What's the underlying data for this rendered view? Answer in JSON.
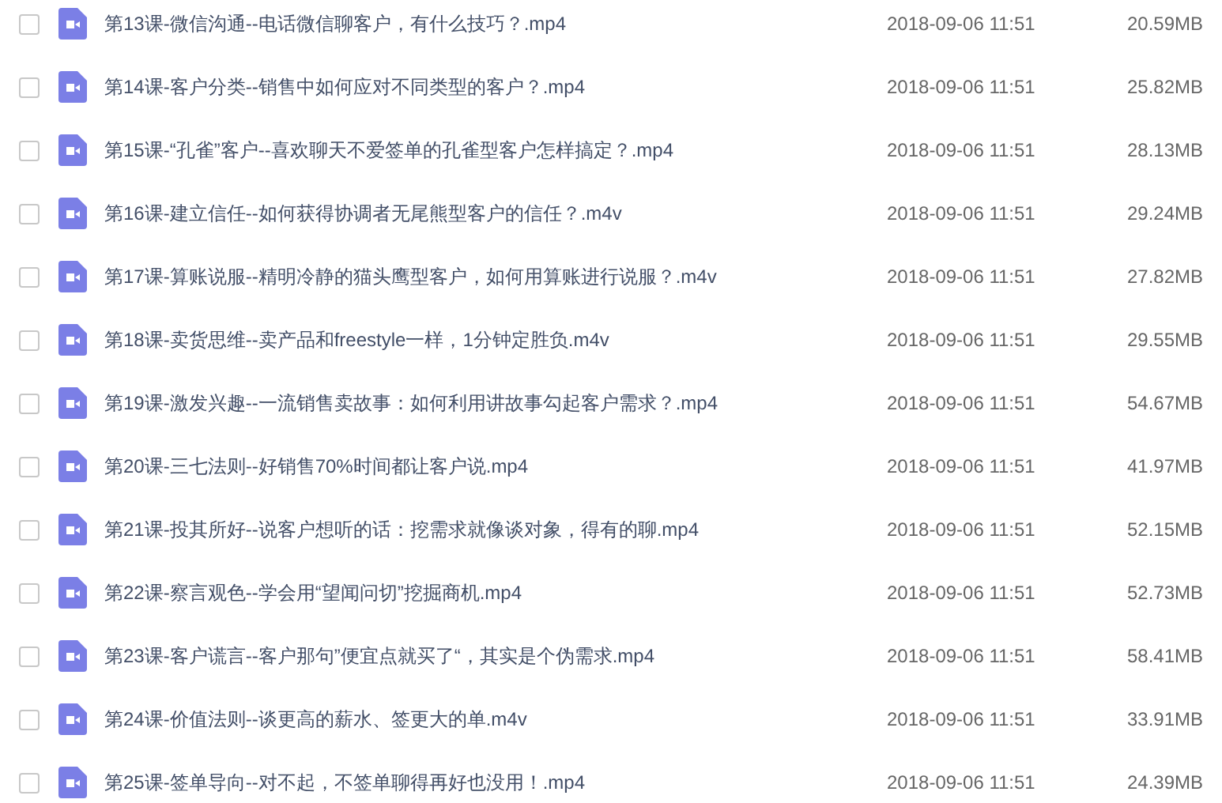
{
  "files": [
    {
      "name": "第13课-微信沟通--电话微信聊客户，有什么技巧？.mp4",
      "date": "2018-09-06 11:51",
      "size": "20.59MB",
      "checked": false
    },
    {
      "name": "第14课-客户分类--销售中如何应对不同类型的客户？.mp4",
      "date": "2018-09-06 11:51",
      "size": "25.82MB",
      "checked": false
    },
    {
      "name": "第15课-“孔雀”客户--喜欢聊天不爱签单的孔雀型客户怎样搞定？.mp4",
      "date": "2018-09-06 11:51",
      "size": "28.13MB",
      "checked": false
    },
    {
      "name": "第16课-建立信任--如何获得协调者无尾熊型客户的信任？.m4v",
      "date": "2018-09-06 11:51",
      "size": "29.24MB",
      "checked": false
    },
    {
      "name": "第17课-算账说服--精明冷静的猫头鹰型客户，如何用算账进行说服？.m4v",
      "date": "2018-09-06 11:51",
      "size": "27.82MB",
      "checked": false
    },
    {
      "name": "第18课-卖货思维--卖产品和freestyle一样，1分钟定胜负.m4v",
      "date": "2018-09-06 11:51",
      "size": "29.55MB",
      "checked": false
    },
    {
      "name": "第19课-激发兴趣--一流销售卖故事：如何利用讲故事勾起客户需求？.mp4",
      "date": "2018-09-06 11:51",
      "size": "54.67MB",
      "checked": false
    },
    {
      "name": "第20课-三七法则--好销售70%时间都让客户说.mp4",
      "date": "2018-09-06 11:51",
      "size": "41.97MB",
      "checked": false
    },
    {
      "name": "第21课-投其所好--说客户想听的话：挖需求就像谈对象，得有的聊.mp4",
      "date": "2018-09-06 11:51",
      "size": "52.15MB",
      "checked": false
    },
    {
      "name": "第22课-察言观色--学会用“望闻问切”挖掘商机.mp4",
      "date": "2018-09-06 11:51",
      "size": "52.73MB",
      "checked": false
    },
    {
      "name": "第23课-客户谎言--客户那句”便宜点就买了“，其实是个伪需求.mp4",
      "date": "2018-09-06 11:51",
      "size": "58.41MB",
      "checked": false
    },
    {
      "name": "第24课-价值法则--谈更高的薪水、签更大的单.m4v",
      "date": "2018-09-06 11:51",
      "size": "33.91MB",
      "checked": false
    },
    {
      "name": "第25课-签单导向--对不起，不签单聊得再好也没用！.mp4",
      "date": "2018-09-06 11:51",
      "size": "24.39MB",
      "checked": false
    }
  ]
}
